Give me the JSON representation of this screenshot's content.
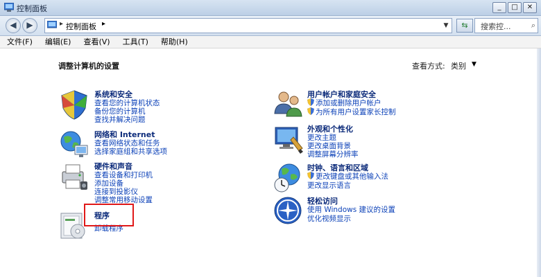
{
  "window": {
    "title": "控制面板"
  },
  "nav": {
    "back_icon": "back-arrow-icon",
    "forward_icon": "forward-arrow-icon",
    "breadcrumb": "控制面板",
    "search_placeholder": "搜索控..."
  },
  "menu": [
    "文件(F)",
    "编辑(E)",
    "查看(V)",
    "工具(T)",
    "帮助(H)"
  ],
  "page": {
    "title": "调整计算机的设置",
    "view_by_label": "查看方式:",
    "view_by_value": "类别"
  },
  "categories_left": [
    {
      "title": "系统和安全",
      "links": [
        "查看您的计算机状态",
        "备份您的计算机",
        "查找并解决问题"
      ]
    },
    {
      "title": "网络和 Internet",
      "links": [
        "查看网络状态和任务",
        "选择家庭组和共享选项"
      ]
    },
    {
      "title": "硬件和声音",
      "links": [
        "查看设备和打印机",
        "添加设备",
        "连接到投影仪",
        "调整常用移动设置"
      ]
    },
    {
      "title": "程序",
      "links": [
        "卸载程序"
      ]
    }
  ],
  "categories_right": [
    {
      "title": "用户帐户和家庭安全",
      "links": [
        "添加或删除用户帐户",
        "为所有用户设置家长控制"
      ]
    },
    {
      "title": "外观和个性化",
      "links": [
        "更改主题",
        "更改桌面背景",
        "调整屏幕分辨率"
      ]
    },
    {
      "title": "时钟、语言和区域",
      "links": [
        "更改键盘或其他输入法",
        "更改显示语言"
      ]
    },
    {
      "title": "轻松访问",
      "links": [
        "使用 Windows 建议的设置",
        "优化视频显示"
      ]
    }
  ],
  "colors": {
    "title_text": "#0b2a7a",
    "link_text": "#0d42b8",
    "highlight_box": "#e01818"
  }
}
